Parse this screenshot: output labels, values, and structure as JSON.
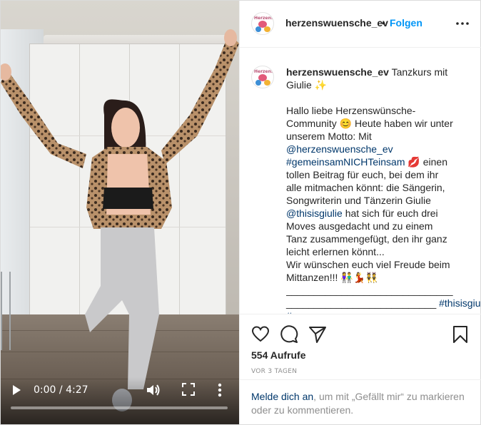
{
  "account": {
    "username": "herzenswuensche_ev",
    "separator": "•",
    "follow_label": "Folgen",
    "avatar_text": "Herzenswünsche e.V."
  },
  "video": {
    "current_time": "0:00",
    "time_separator": " / ",
    "duration": "4:27",
    "progress_fraction": 0.0
  },
  "caption": {
    "username": "herzenswuensche_ev",
    "title": " Tanzkurs mit Giulie ✨",
    "l1": "Hallo liebe Herzenswünsche-Community 😊 Heute haben wir unter unserem Motto: Mit ",
    "mention1": "@herzenswuensche_ev",
    "hashtag1": "#gemeinsamNICHTeinsam",
    "l2": " 💋 einen tollen Beitrag für euch, bei dem ihr alle mitmachen könnt: die Sängerin, Songwriterin und Tänzerin Giulie ",
    "mention2": "@thisisgiulie",
    "l3": " hat sich für euch drei Moves ausgedacht und zu einem Tanz zusammengefügt, den ihr ganz leicht erlernen könnt...",
    "l4": "Wir wünschen euch viel Freude beim Mittanzen!!! 👫💃👯",
    "rule1": "______________________________",
    "rule2": "___________________________ ",
    "hashtag2": "#thisisgiulie",
    "rule3": "#"
  },
  "stats": {
    "views": "554 Aufrufe",
    "date": "VOR 3 TAGEN"
  },
  "login": {
    "link": "Melde dich an",
    "text": ", um mit „Gefällt mir“ zu markieren oder zu kommentieren."
  },
  "icons": {
    "like": "heart-icon",
    "comment": "comment-icon",
    "share": "paper-plane-icon",
    "save": "bookmark-icon",
    "play": "play-icon",
    "volume": "volume-icon",
    "fullscreen": "fullscreen-icon",
    "more": "more-vertical-icon",
    "options": "more-horizontal-icon"
  },
  "colors": {
    "accent": "#0095f6",
    "link": "#00376b",
    "muted": "#8e8e8e",
    "text": "#262626"
  }
}
